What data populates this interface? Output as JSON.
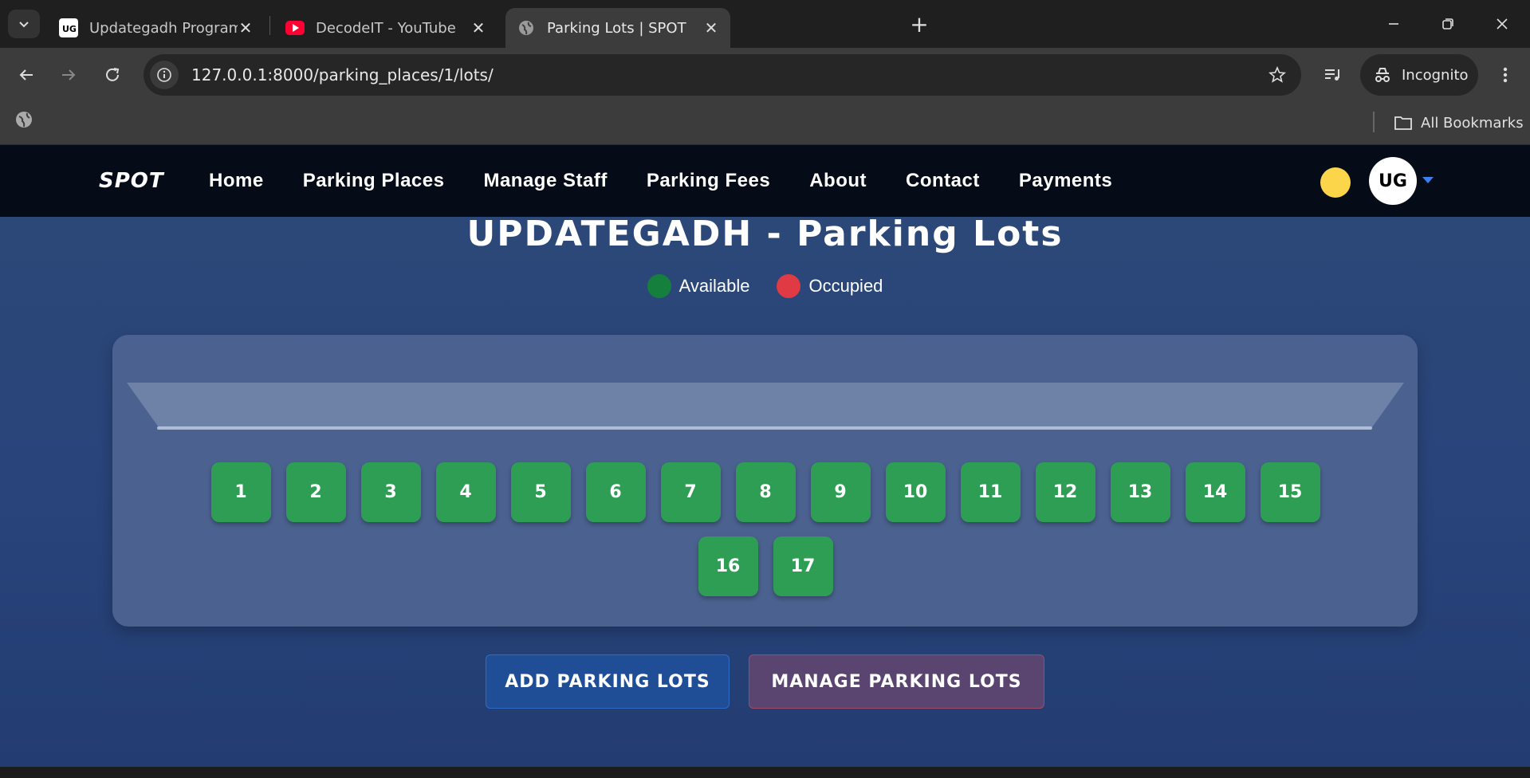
{
  "browser": {
    "tabs": [
      {
        "title": "Updategadh Programming - Up",
        "favicon": "ug-favicon",
        "active": false
      },
      {
        "title": "DecodeIT - YouTube",
        "favicon": "youtube-favicon",
        "active": false
      },
      {
        "title": "Parking Lots | SPOT",
        "favicon": "globe-favicon",
        "active": true
      }
    ],
    "url": "127.0.0.1:8000/parking_places/1/lots/",
    "incognito_label": "Incognito",
    "all_bookmarks_label": "All Bookmarks"
  },
  "site": {
    "brand": "SPOT",
    "nav": [
      "Home",
      "Parking Places",
      "Manage Staff",
      "Parking Fees",
      "About",
      "Contact",
      "Payments"
    ],
    "avatar_text": "UG",
    "page_title": "UPDATEGADH - Parking Lots",
    "legend": {
      "available": "Available",
      "occupied": "Occupied"
    },
    "slots": [
      "1",
      "2",
      "3",
      "4",
      "5",
      "6",
      "7",
      "8",
      "9",
      "10",
      "11",
      "12",
      "13",
      "14",
      "15",
      "16",
      "17"
    ],
    "buttons": {
      "add": "ADD PARKING LOTS",
      "manage": "MANAGE PARKING LOTS"
    }
  },
  "colors": {
    "available": "#2f9e55",
    "occupied": "#e03a45",
    "theme_toggle": "#fdd54b",
    "nav_bg": "#060b18",
    "page_bg": "#28447a"
  }
}
